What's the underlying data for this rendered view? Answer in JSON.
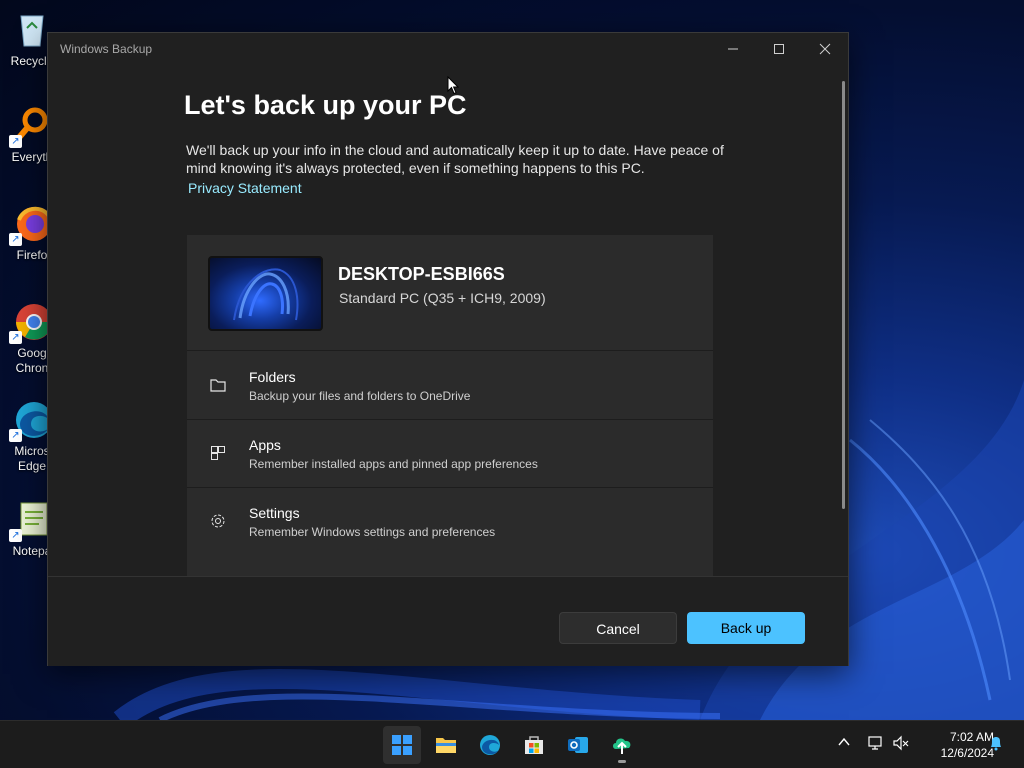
{
  "desktop": {
    "icons": [
      {
        "label": "Recycle",
        "icon": "recycle-bin-icon"
      },
      {
        "label": "Everyth",
        "icon": "everything-search-icon"
      },
      {
        "label": "Firefo",
        "icon": "firefox-icon"
      },
      {
        "label": "Goog Chron",
        "icon": "chrome-icon"
      },
      {
        "label": "Micros Edge",
        "icon": "edge-icon"
      },
      {
        "label": "Notepa",
        "icon": "notepad-plus-icon"
      }
    ]
  },
  "window": {
    "title": "Windows Backup",
    "heading": "Let's back up your PC",
    "intro": "We'll back up your info in the cloud and automatically keep it up to date. Have peace of mind knowing it's always protected, even if something happens to this PC.",
    "privacy_link": "Privacy Statement",
    "device": {
      "name": "DESKTOP-ESBI66S",
      "spec": "Standard PC (Q35 + ICH9, 2009)"
    },
    "options": [
      {
        "title": "Folders",
        "desc": "Backup your files and folders to OneDrive",
        "icon": "folder-icon"
      },
      {
        "title": "Apps",
        "desc": "Remember installed apps and pinned app preferences",
        "icon": "apps-icon"
      },
      {
        "title": "Settings",
        "desc": "Remember Windows settings and preferences",
        "icon": "gear-icon"
      }
    ],
    "buttons": {
      "cancel": "Cancel",
      "backup": "Back up"
    }
  },
  "taskbar": {
    "apps": [
      "start-icon",
      "file-explorer-icon",
      "edge-icon",
      "microsoft-store-icon",
      "outlook-icon",
      "windows-backup-icon"
    ],
    "tray": [
      "chevron-up-icon",
      "network-icon",
      "volume-muted-icon",
      "notification-bell-icon"
    ],
    "clock": {
      "time": "7:02 AM",
      "date": "12/6/2024"
    }
  },
  "colors": {
    "accent": "#4cc2ff",
    "link": "#99ebff",
    "window_bg": "#202020",
    "card_bg": "#2b2b2b"
  }
}
